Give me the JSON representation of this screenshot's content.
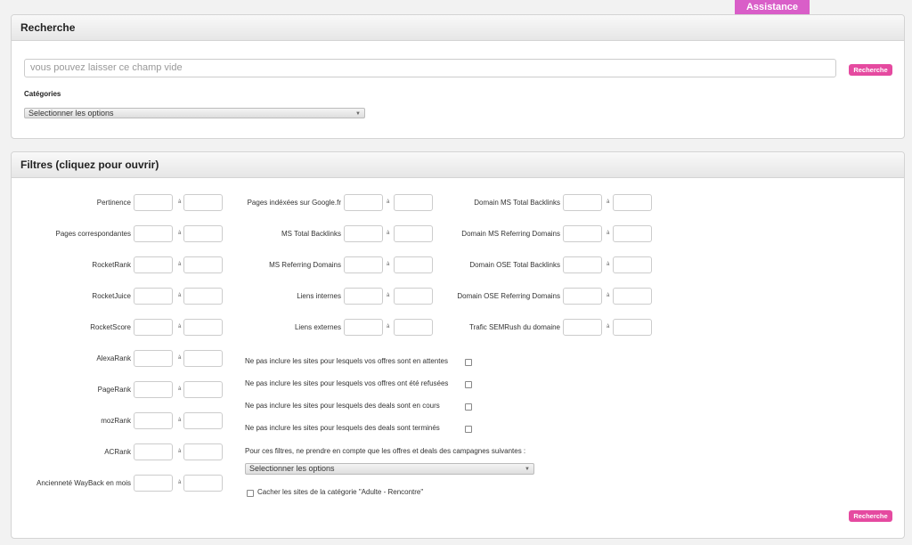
{
  "assistance_tab": "Assistance",
  "search_panel": {
    "title": "Recherche",
    "input_placeholder": "vous pouvez laisser ce champ vide",
    "button": "Recherche",
    "categories_label": "Catégories",
    "categories_select": "Selectionner les options"
  },
  "filters_panel": {
    "title": "Filtres (cliquez pour ouvrir)",
    "separator": "à",
    "col1": [
      "Pertinence",
      "Pages correspondantes",
      "RocketRank",
      "RocketJuice",
      "RocketScore",
      "AlexaRank",
      "PageRank",
      "mozRank",
      "ACRank",
      "Ancienneté WayBack en mois"
    ],
    "col2": [
      "Pages indéxées sur Google.fr",
      "MS Total Backlinks",
      "MS Referring Domains",
      "Liens internes",
      "Liens externes"
    ],
    "col3": [
      "Domain MS Total Backlinks",
      "Domain MS Referring Domains",
      "Domain OSE Total Backlinks",
      "Domain OSE Referring Domains",
      "Trafic SEMRush du domaine"
    ],
    "checkboxes": [
      "Ne pas inclure les sites pour lesquels vos offres sont en attentes",
      "Ne pas inclure les sites pour lesquels vos offres ont été refusées",
      "Ne pas inclure les sites pour lesquels des deals sont en cours",
      "Ne pas inclure les sites pour lesquels des deals sont terminés"
    ],
    "campaigns_label": "Pour ces filtres, ne prendre en compte que les offres et deals des campagnes suivantes :",
    "campaigns_select": "Selectionner les options",
    "hide_adult_label": "Cacher les sites de la catégorie \"Adulte - Rencontre\"",
    "button": "Recherche"
  }
}
